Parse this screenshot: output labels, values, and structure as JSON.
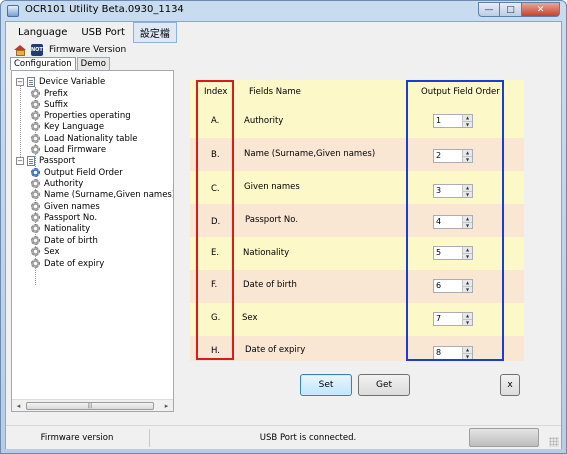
{
  "window": {
    "title": "OCR101 Utility Beta.0930_1134",
    "minimize_glyph": "—",
    "maximize_glyph": "□",
    "close_glyph": "✕"
  },
  "menu": {
    "items": [
      {
        "label": "Language"
      },
      {
        "label": "USB Port"
      },
      {
        "label": "設定檔"
      }
    ]
  },
  "toolbar": {
    "note_icon_text": "NOTE",
    "firmware_version_label": "Firmware Version"
  },
  "tabs": [
    {
      "label": "Configuration",
      "selected": true
    },
    {
      "label": "Demo",
      "selected": false
    }
  ],
  "tree": {
    "groups": [
      {
        "label": "Device Variable",
        "expander": "−",
        "children": [
          "Prefix",
          "Suffix",
          "Properties operating",
          "Key Language",
          "Load Nationality table",
          "Load Firmware"
        ]
      },
      {
        "label": "Passport",
        "expander": "−",
        "children": [
          "Output Field Order",
          "Authority",
          "Name (Surname,Given names)",
          "Given names",
          "Passport No.",
          "Nationality",
          "Date of birth",
          "Sex",
          "Date of expiry"
        ]
      }
    ],
    "scroll_left": "◂",
    "scroll_right": "▸",
    "scroll_grip": "|||"
  },
  "grid": {
    "headers": {
      "index": "Index",
      "fields_name": "Fields Name",
      "output_field_order": "Output Field Order"
    },
    "rows": [
      {
        "index": "A.",
        "field": "Authority",
        "order": "1"
      },
      {
        "index": "B.",
        "field": "Name (Surname,Given names)",
        "order": "2"
      },
      {
        "index": "C.",
        "field": "Given names",
        "order": "3"
      },
      {
        "index": "D.",
        "field": "Passport No.",
        "order": "4"
      },
      {
        "index": "E.",
        "field": "Nationality",
        "order": "5"
      },
      {
        "index": "F.",
        "field": "Date of birth",
        "order": "6"
      },
      {
        "index": "G.",
        "field": "Sex",
        "order": "7"
      },
      {
        "index": "H.",
        "field": "Date of expiry",
        "order": "8"
      }
    ],
    "spin_up": "▲",
    "spin_down": "▼",
    "highlight_colors": {
      "index": "#d81b1b",
      "output_field_order": "#1a3dd6"
    }
  },
  "buttons": {
    "set": "Set",
    "get": "Get",
    "close": "x"
  },
  "statusbar": {
    "firmware": "Firmware version",
    "usb": "USB Port is connected."
  }
}
